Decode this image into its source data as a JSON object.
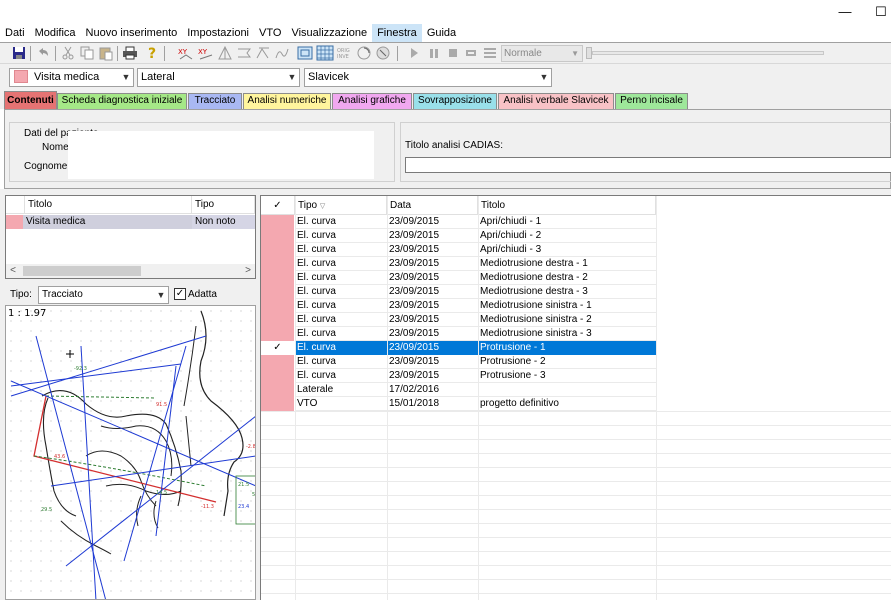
{
  "window": {
    "min_glyph": "—",
    "max_glyph": "☐"
  },
  "menu": [
    "Dati",
    "Modifica",
    "Nuovo inserimento",
    "Impostazioni",
    "VTO",
    "Visualizzazione",
    "Finestra",
    "Guida"
  ],
  "toolbar": {
    "speed_value": "Normale"
  },
  "dropdowns": {
    "exam": "Visita medica",
    "view": "Lateral",
    "analysis": "Slavicek"
  },
  "tabs": [
    {
      "label": "Contenuti",
      "color": "#e57373",
      "active": true
    },
    {
      "label": "Scheda diagnostica iniziale",
      "color": "#a5e887"
    },
    {
      "label": "Tracciato",
      "color": "#a9b8f3"
    },
    {
      "label": "Analisi numeriche",
      "color": "#fff59d"
    },
    {
      "label": "Analisi grafiche",
      "color": "#f1a8f0"
    },
    {
      "label": "Sovrapposizione",
      "color": "#99e0ea"
    },
    {
      "label": "Analisi verbale Slavicek",
      "color": "#f8c2c6"
    },
    {
      "label": "Perno incisale",
      "color": "#9ee79a"
    }
  ],
  "patient": {
    "group_title": "Dati del paziente",
    "name_label": "Nome:",
    "surname_label": "Cognome:",
    "cadias_title": "Titolo analisi CADIAS:"
  },
  "left_list": {
    "headers": [
      "Titolo",
      "Tipo"
    ],
    "rows": [
      {
        "title": "Visita medica",
        "type": "Non noto"
      }
    ]
  },
  "tracing": {
    "tipo_label": "Tipo:",
    "tipo_value": "Tracciato",
    "adatta_label": "Adatta",
    "adatta_checked": true,
    "scale": "1 : 1.97"
  },
  "grid": {
    "headers": [
      "Tipo",
      "Data",
      "Titolo"
    ],
    "rows": [
      {
        "check": false,
        "tipo": "El. curva",
        "data": "23/09/2015",
        "titolo": "Apri/chiudi - 1",
        "pink": true
      },
      {
        "check": false,
        "tipo": "El. curva",
        "data": "23/09/2015",
        "titolo": "Apri/chiudi - 2",
        "pink": true
      },
      {
        "check": false,
        "tipo": "El. curva",
        "data": "23/09/2015",
        "titolo": "Apri/chiudi - 3",
        "pink": true
      },
      {
        "check": false,
        "tipo": "El. curva",
        "data": "23/09/2015",
        "titolo": "Mediotrusione destra - 1",
        "pink": true
      },
      {
        "check": false,
        "tipo": "El. curva",
        "data": "23/09/2015",
        "titolo": "Mediotrusione destra - 2",
        "pink": true
      },
      {
        "check": false,
        "tipo": "El. curva",
        "data": "23/09/2015",
        "titolo": "Mediotrusione destra - 3",
        "pink": true
      },
      {
        "check": false,
        "tipo": "El. curva",
        "data": "23/09/2015",
        "titolo": "Mediotrusione sinistra - 1",
        "pink": true
      },
      {
        "check": false,
        "tipo": "El. curva",
        "data": "23/09/2015",
        "titolo": "Mediotrusione sinistra - 2",
        "pink": true
      },
      {
        "check": false,
        "tipo": "El. curva",
        "data": "23/09/2015",
        "titolo": "Mediotrusione sinistra - 3",
        "pink": true
      },
      {
        "check": true,
        "tipo": "El. curva",
        "data": "23/09/2015",
        "titolo": "Protrusione - 1",
        "pink": false,
        "selected": true
      },
      {
        "check": false,
        "tipo": "El. curva",
        "data": "23/09/2015",
        "titolo": "Protrusione - 2",
        "pink": true
      },
      {
        "check": false,
        "tipo": "El. curva",
        "data": "23/09/2015",
        "titolo": "Protrusione - 3",
        "pink": true
      },
      {
        "check": false,
        "tipo": "Laterale",
        "data": "17/02/2016",
        "titolo": "",
        "pink": true
      },
      {
        "check": false,
        "tipo": "VTO",
        "data": "15/01/2018",
        "titolo": "progetto definitivo",
        "pink": true
      }
    ]
  },
  "colors": {
    "pink": "#f4a8b0",
    "selection": "#0078d7"
  }
}
